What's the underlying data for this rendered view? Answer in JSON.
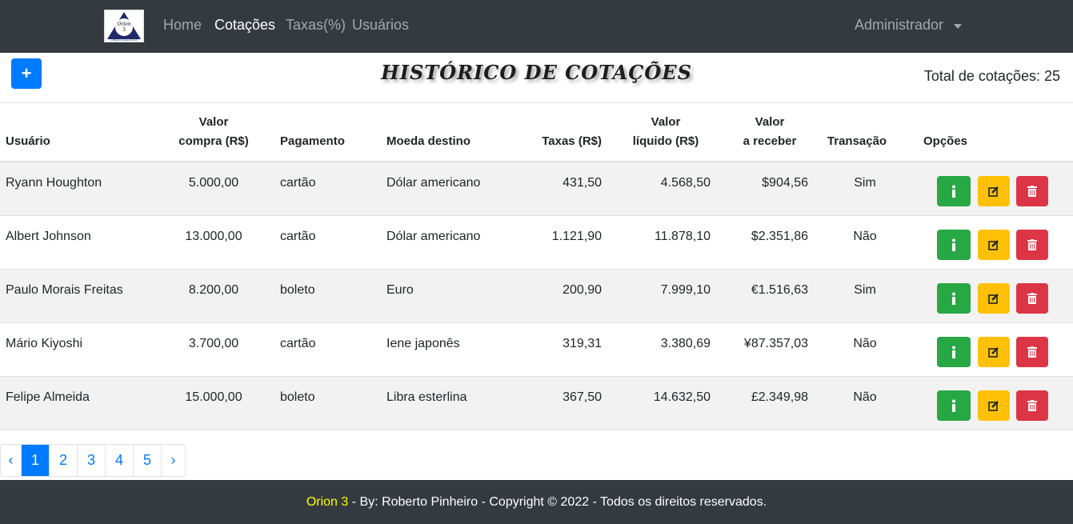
{
  "nav": {
    "logo_text_top": "Orion",
    "logo_text_num": "3",
    "logo_subtitle": "software development",
    "links": [
      "Home",
      "Cotações",
      "Taxas(%)",
      "Usuários"
    ],
    "active": "Cotações",
    "user_menu": "Administrador"
  },
  "header": {
    "add_label": "+",
    "title": "HISTÓRICO DE COTAÇÕES",
    "total": "Total de cotações: 25"
  },
  "table": {
    "columns": [
      {
        "line1": "",
        "line2": "Usuário"
      },
      {
        "line1": "Valor",
        "line2": "compra (R$)"
      },
      {
        "line1": "",
        "line2": "Pagamento"
      },
      {
        "line1": "",
        "line2": "Moeda destino"
      },
      {
        "line1": "",
        "line2": "Taxas (R$)"
      },
      {
        "line1": "Valor",
        "line2": "líquido (R$)"
      },
      {
        "line1": "Valor",
        "line2": "a receber"
      },
      {
        "line1": "",
        "line2": "Transação"
      },
      {
        "line1": "",
        "line2": "Opções"
      }
    ],
    "rows": [
      {
        "usuario": "Ryann Houghton",
        "compra": "5.000,00",
        "pagamento": "cartão",
        "moeda": "Dólar americano",
        "taxas": "431,50",
        "liquido": "4.568,50",
        "receber": "$904,56",
        "transacao": "Sim"
      },
      {
        "usuario": "Albert Johnson",
        "compra": "13.000,00",
        "pagamento": "cartão",
        "moeda": "Dólar americano",
        "taxas": "1.121,90",
        "liquido": "11.878,10",
        "receber": "$2.351,86",
        "transacao": "Não"
      },
      {
        "usuario": "Paulo Morais Freitas",
        "compra": "8.200,00",
        "pagamento": "boleto",
        "moeda": "Euro",
        "taxas": "200,90",
        "liquido": "7.999,10",
        "receber": "€1.516,63",
        "transacao": "Sim"
      },
      {
        "usuario": "Mário Kiyoshi",
        "compra": "3.700,00",
        "pagamento": "cartão",
        "moeda": "Iene japonês",
        "taxas": "319,31",
        "liquido": "3.380,69",
        "receber": "¥87.357,03",
        "transacao": "Não"
      },
      {
        "usuario": "Felipe Almeida",
        "compra": "15.000,00",
        "pagamento": "boleto",
        "moeda": "Libra esterlina",
        "taxas": "367,50",
        "liquido": "14.632,50",
        "receber": "£2.349,98",
        "transacao": "Não"
      }
    ],
    "action_icons": [
      "info-icon",
      "edit-icon",
      "trash-icon"
    ]
  },
  "pagination": {
    "prev": "‹",
    "pages": [
      "1",
      "2",
      "3",
      "4",
      "5"
    ],
    "current": "1",
    "next": "›"
  },
  "footer": {
    "brand": "Orion 3",
    "text": " - By: Roberto Pinheiro - Copyright © 2022 - Todos os direitos reservados."
  },
  "colors": {
    "navbar": "#343a40",
    "primary": "#007bff",
    "success": "#28a745",
    "warning": "#ffc107",
    "danger": "#dc3545",
    "footer_brand": "#ffff00"
  }
}
